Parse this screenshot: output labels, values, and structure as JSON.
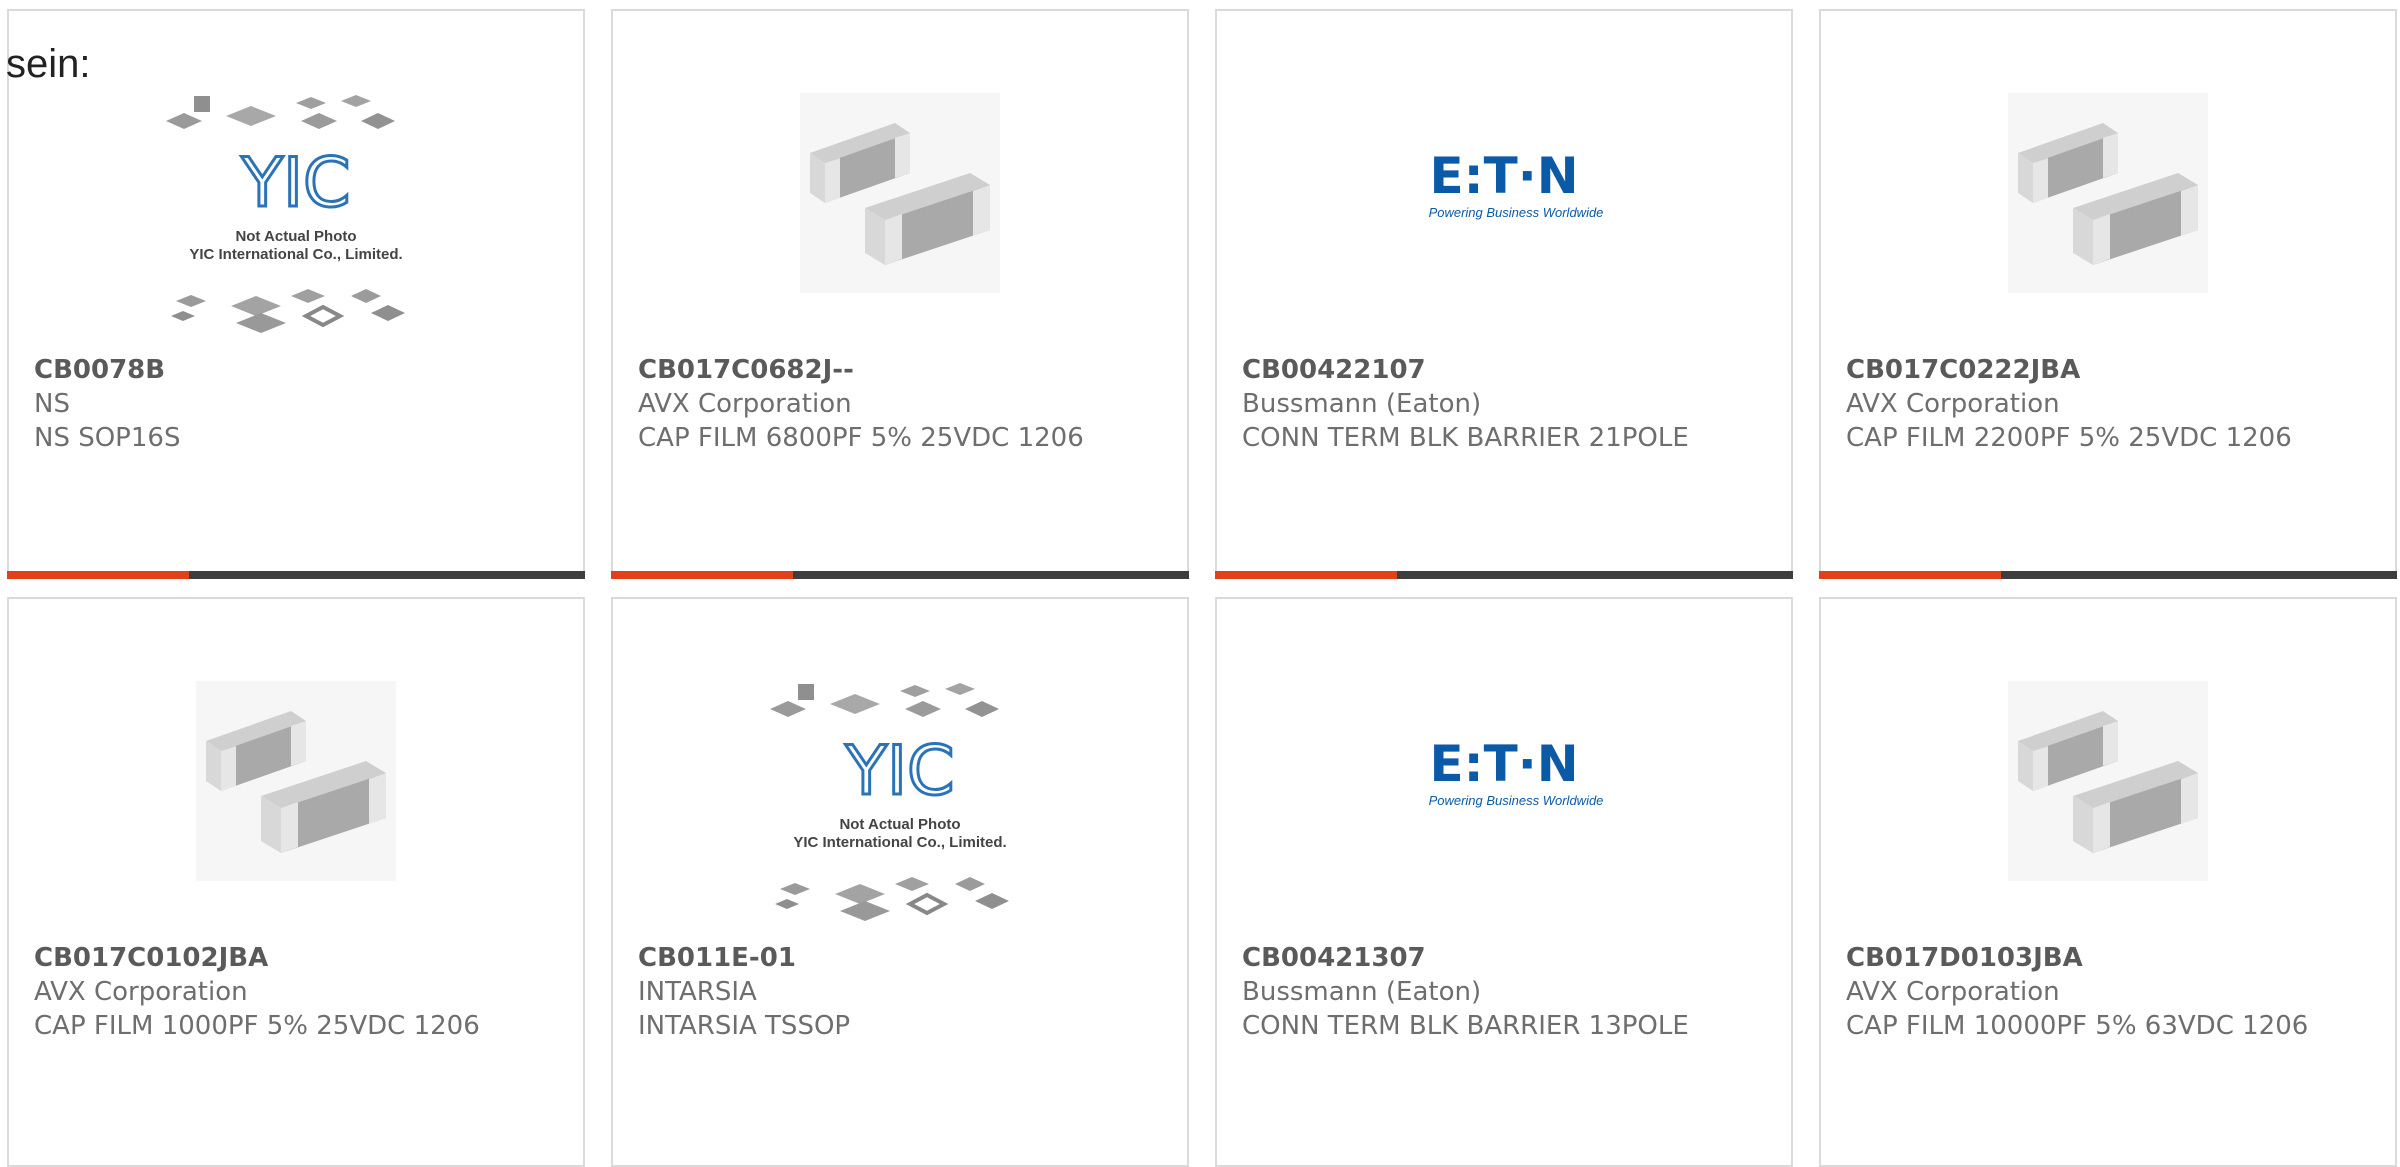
{
  "page": {
    "fragment_text": "sein:"
  },
  "colors": {
    "accent": "#e2401b",
    "bar": "#3e3e3e",
    "border": "#dadada",
    "text": "#6e6e6e",
    "eaton_blue": "#0a5aa8",
    "yic_blue": "#2b73b8"
  },
  "yic_image": {
    "caption_line1": "Not Actual Photo",
    "caption_line2": "YIC International Co., Limited.",
    "logo_text": "YIC"
  },
  "eaton_image": {
    "logo_text": "E:T·N",
    "tagline": "Powering Business Worldwide"
  },
  "products": [
    {
      "part_number": "CB0078B",
      "manufacturer": "NS",
      "description": "NS SOP16S",
      "image": "yic-placeholder"
    },
    {
      "part_number": "CB017C0682J--",
      "manufacturer": "AVX Corporation",
      "description": "CAP FILM 6800PF 5% 25VDC 1206",
      "image": "chip-capacitor"
    },
    {
      "part_number": "CB00422107",
      "manufacturer": "Bussmann (Eaton)",
      "description": "CONN TERM BLK BARRIER 21POLE",
      "image": "eaton-logo"
    },
    {
      "part_number": "CB017C0222JBA",
      "manufacturer": "AVX Corporation",
      "description": "CAP FILM 2200PF 5% 25VDC 1206",
      "image": "chip-capacitor"
    },
    {
      "part_number": "CB017C0102JBA",
      "manufacturer": "AVX Corporation",
      "description": "CAP FILM 1000PF 5% 25VDC 1206",
      "image": "chip-capacitor"
    },
    {
      "part_number": "CB011E-01",
      "manufacturer": "INTARSIA",
      "description": "INTARSIA TSSOP",
      "image": "yic-placeholder"
    },
    {
      "part_number": "CB00421307",
      "manufacturer": "Bussmann (Eaton)",
      "description": "CONN TERM BLK BARRIER 13POLE",
      "image": "eaton-logo"
    },
    {
      "part_number": "CB017D0103JBA",
      "manufacturer": "AVX Corporation",
      "description": "CAP FILM 10000PF 5% 63VDC 1206",
      "image": "chip-capacitor"
    }
  ]
}
